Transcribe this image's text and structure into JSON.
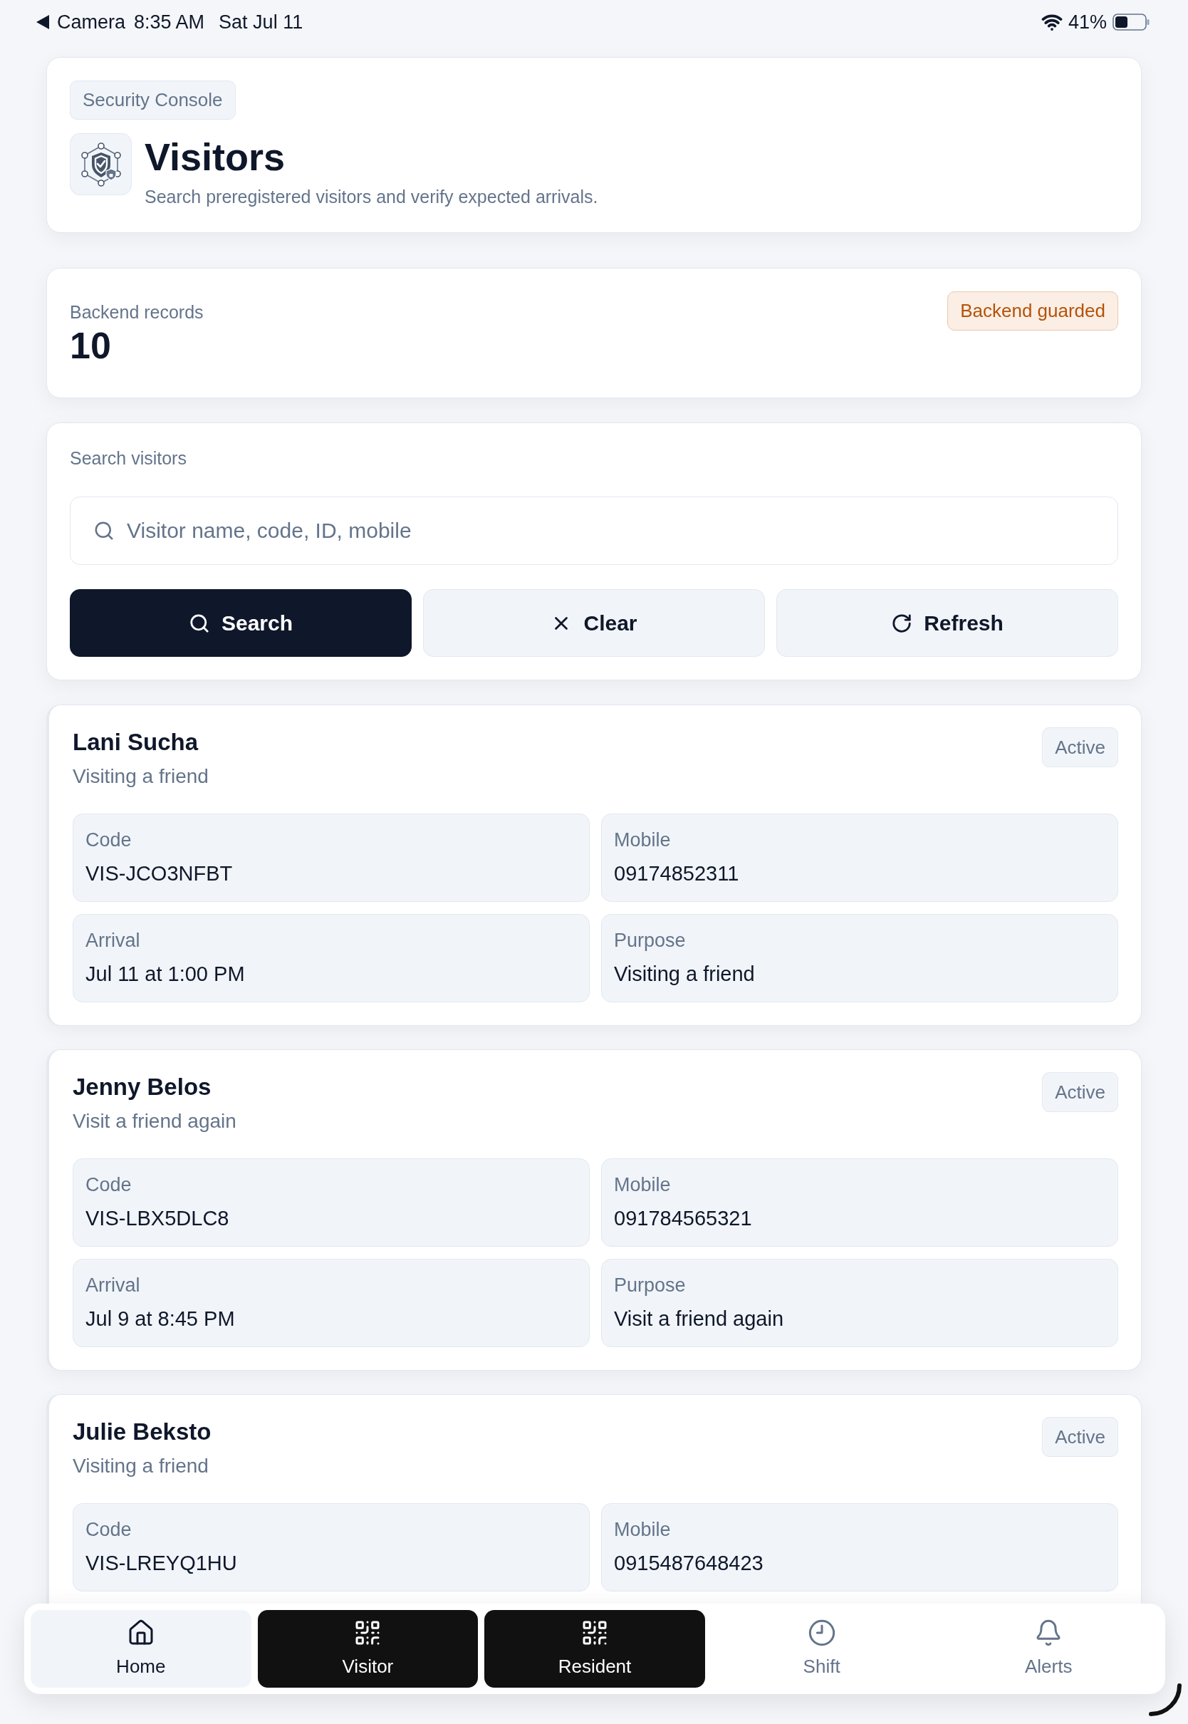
{
  "status_bar": {
    "back_app": "Camera",
    "time": "8:35 AM",
    "date": "Sat Jul 11",
    "battery": "41%"
  },
  "header": {
    "chip": "Security Console",
    "title": "Visitors",
    "subtitle": "Search preregistered visitors and verify expected arrivals."
  },
  "records": {
    "label": "Backend records",
    "count": "10",
    "badge": "Backend guarded"
  },
  "search": {
    "label": "Search visitors",
    "placeholder": "Visitor name, code, ID, mobile",
    "buttons": [
      {
        "label": "Search",
        "kind": "primary"
      },
      {
        "label": "Clear",
        "kind": "secondary"
      },
      {
        "label": "Refresh",
        "kind": "secondary"
      }
    ]
  },
  "visitors": [
    {
      "name": "Lani Sucha",
      "purpose": "Visiting a friend",
      "status": "Active",
      "fields": [
        {
          "label": "Code",
          "value": "VIS-JCO3NFBT"
        },
        {
          "label": "Mobile",
          "value": "09174852311"
        },
        {
          "label": "Arrival",
          "value": "Jul 11 at 1:00 PM"
        },
        {
          "label": "Purpose",
          "value": "Visiting a friend"
        }
      ]
    },
    {
      "name": "Jenny Belos",
      "purpose": "Visit a friend again",
      "status": "Active",
      "fields": [
        {
          "label": "Code",
          "value": "VIS-LBX5DLC8"
        },
        {
          "label": "Mobile",
          "value": "091784565321"
        },
        {
          "label": "Arrival",
          "value": "Jul 9 at 8:45 PM"
        },
        {
          "label": "Purpose",
          "value": "Visit a friend again"
        }
      ]
    },
    {
      "name": "Julie Beksto",
      "purpose": "Visiting a friend",
      "status": "Active",
      "fields": [
        {
          "label": "Code",
          "value": "VIS-LREYQ1HU"
        },
        {
          "label": "Mobile",
          "value": "0915487648423"
        }
      ]
    }
  ],
  "bottom_nav": [
    {
      "label": "Home",
      "kind": "tab",
      "selected": true
    },
    {
      "label": "Visitor",
      "kind": "action",
      "selected": false
    },
    {
      "label": "Resident",
      "kind": "action",
      "selected": false
    },
    {
      "label": "Shift",
      "kind": "tab",
      "selected": false
    },
    {
      "label": "Alerts",
      "kind": "tab",
      "selected": false
    }
  ]
}
